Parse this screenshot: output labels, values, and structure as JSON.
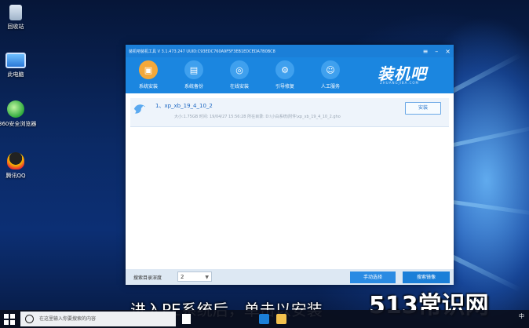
{
  "desktop": {
    "icons": [
      {
        "label": "回收站",
        "icon": "recycle-bin-icon"
      },
      {
        "label": "此电脑",
        "icon": "computer-icon"
      },
      {
        "label": "360安全浏览器",
        "icon": "browser-360-icon"
      },
      {
        "label": "腾讯QQ",
        "icon": "qq-penguin-icon"
      }
    ]
  },
  "window": {
    "title": "装机吧装机工具 V 3.1.473.247 UUID:C93EDC760A9F5F3EB1EDCEDA7B0BC8",
    "controls": {
      "menu": "≡",
      "minimize": "–",
      "close": "×"
    },
    "toolbar": [
      {
        "label": "系统安装",
        "icon": "system-install-icon",
        "active": true
      },
      {
        "label": "系统备份",
        "icon": "system-backup-icon",
        "active": false
      },
      {
        "label": "在线安装",
        "icon": "online-install-icon",
        "active": false
      },
      {
        "label": "引导修复",
        "icon": "boot-repair-icon",
        "active": false
      },
      {
        "label": "人工服务",
        "icon": "support-icon",
        "active": false
      }
    ],
    "brand": {
      "name": "装机吧",
      "sub": "ZHUANGJIBA.COM"
    },
    "list": [
      {
        "name": "1、xp_xb_19_4_10_2",
        "meta": "大小:1.75GB   时间: 19/04/27 15:56:28 所在目录: D:\\小白系统\\附件\\xp_xb_19_4_10_2.gho",
        "action": "安装"
      }
    ],
    "bottom": {
      "depth_label": "搜索目录深度",
      "depth_value": "2",
      "manual_button": "手动选择",
      "search_button": "搜索镜像"
    }
  },
  "overlay": {
    "subtitle": "进入PE系统后，单击以安装",
    "watermark": "513常识网"
  },
  "taskbar": {
    "search_placeholder": "在这里输入你要搜索的内容",
    "tray_text": "中"
  },
  "colors": {
    "accent": "#1b86e0",
    "active_tool": "#f3a83a"
  }
}
